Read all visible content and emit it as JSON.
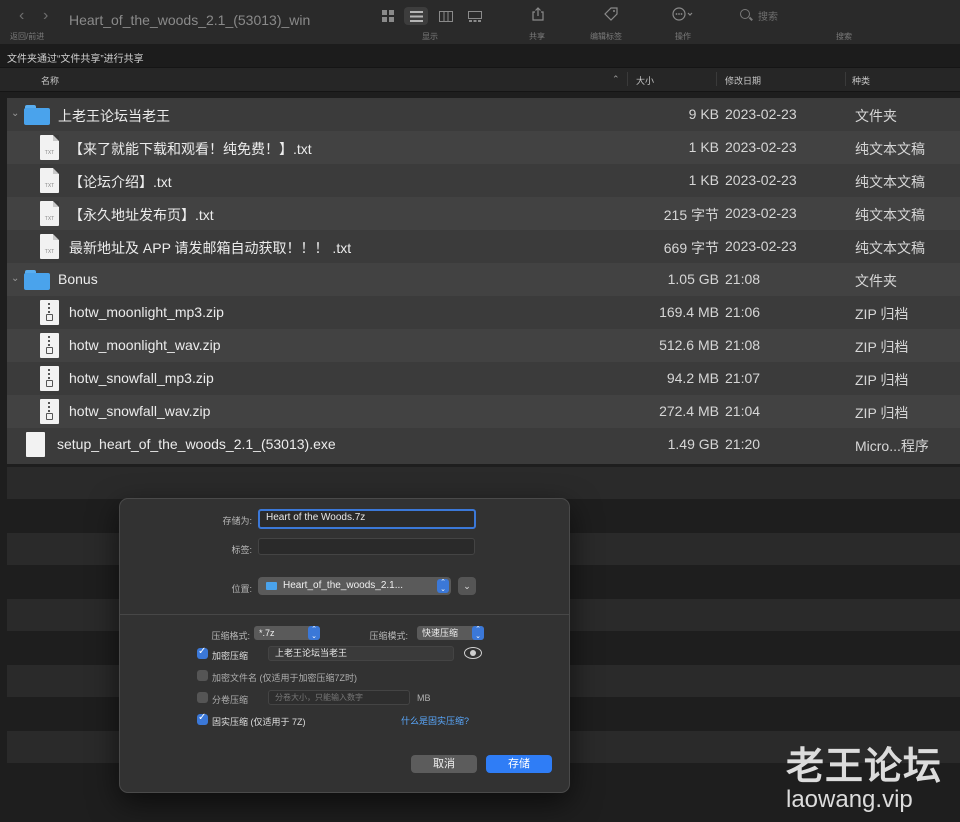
{
  "toolbar": {
    "back_forward_label": "返回/前进",
    "window_title": "Heart_of_the_woods_2.1_(53013)_win",
    "view_label": "显示",
    "share_label": "共享",
    "tags_label": "编辑标签",
    "action_label": "操作",
    "search_placeholder": "搜索",
    "search_label": "搜索"
  },
  "share_bar": {
    "text": "文件夹通过“文件共享”进行共享"
  },
  "columns": {
    "name": "名称",
    "size": "大小",
    "date": "修改日期",
    "kind": "种类"
  },
  "files": [
    {
      "name": "上老王论坛当老王",
      "size": "9 KB",
      "date": "2023-02-23",
      "kind": "文件夹",
      "icon": "folder-icon"
    },
    {
      "name": "【来了就能下载和观看！纯免费！】.txt",
      "size": "1 KB",
      "date": "2023-02-23",
      "kind": "纯文本文稿",
      "icon": "txt-file-icon",
      "icon_text": "TXT"
    },
    {
      "name": "【论坛介绍】.txt",
      "size": "1 KB",
      "date": "2023-02-23",
      "kind": "纯文本文稿",
      "icon": "txt-file-icon",
      "icon_text": "TXT"
    },
    {
      "name": "【永久地址发布页】.txt",
      "size": "215 字节",
      "date": "2023-02-23",
      "kind": "纯文本文稿",
      "icon": "txt-file-icon",
      "icon_text": "TXT"
    },
    {
      "name": "最新地址及 APP 请发邮箱自动获取！！！ .txt",
      "size": "669 字节",
      "date": "2023-02-23",
      "kind": "纯文本文稿",
      "icon": "txt-file-icon",
      "icon_text": "TXT"
    },
    {
      "name": "Bonus",
      "size": "1.05 GB",
      "date": "21:08",
      "kind": "文件夹",
      "icon": "folder-icon"
    },
    {
      "name": "hotw_moonlight_mp3.zip",
      "size": "169.4 MB",
      "date": "21:06",
      "kind": "ZIP 归档",
      "icon": "zip-file-icon"
    },
    {
      "name": "hotw_moonlight_wav.zip",
      "size": "512.6 MB",
      "date": "21:08",
      "kind": "ZIP 归档",
      "icon": "zip-file-icon"
    },
    {
      "name": "hotw_snowfall_mp3.zip",
      "size": "94.2 MB",
      "date": "21:07",
      "kind": "ZIP 归档",
      "icon": "zip-file-icon"
    },
    {
      "name": "hotw_snowfall_wav.zip",
      "size": "272.4 MB",
      "date": "21:04",
      "kind": "ZIP 归档",
      "icon": "zip-file-icon"
    },
    {
      "name": "setup_heart_of_the_woods_2.1_(53013).exe",
      "size": "1.49 GB",
      "date": "21:20",
      "kind": "Micro...程序",
      "icon": "exe-file-icon"
    }
  ],
  "dialog": {
    "save_as_label": "存储为:",
    "save_as_value": "Heart of the Woods.7z",
    "tags_label": "标签:",
    "tags_value": "",
    "location_label": "位置:",
    "location_value": "Heart_of_the_woods_2.1...",
    "format_label": "压缩格式:",
    "format_value": "*.7z",
    "mode_label": "压缩模式:",
    "mode_value": "快速压缩",
    "encrypt_label": "加密压缩",
    "encrypt_checked": true,
    "password_value": "上老王论坛当老王",
    "encrypt_names_label": "加密文件名 (仅适用于加密压缩7Z时)",
    "encrypt_names_checked": false,
    "split_label": "分卷压缩",
    "split_checked": false,
    "split_placeholder": "分卷大小，只能输入数字",
    "split_unit": "MB",
    "solid_label": "固实压缩 (仅适用于 7Z)",
    "solid_checked": true,
    "solid_help_link": "什么是固实压缩?",
    "cancel_label": "取消",
    "save_label": "存储"
  },
  "watermark": {
    "line1": "老王论坛",
    "line2": "laowang.vip"
  },
  "colors": {
    "accent": "#3b78d8",
    "save_button": "#2f7df6",
    "folder": "#4aa3ec",
    "link": "#5aa9ff"
  }
}
